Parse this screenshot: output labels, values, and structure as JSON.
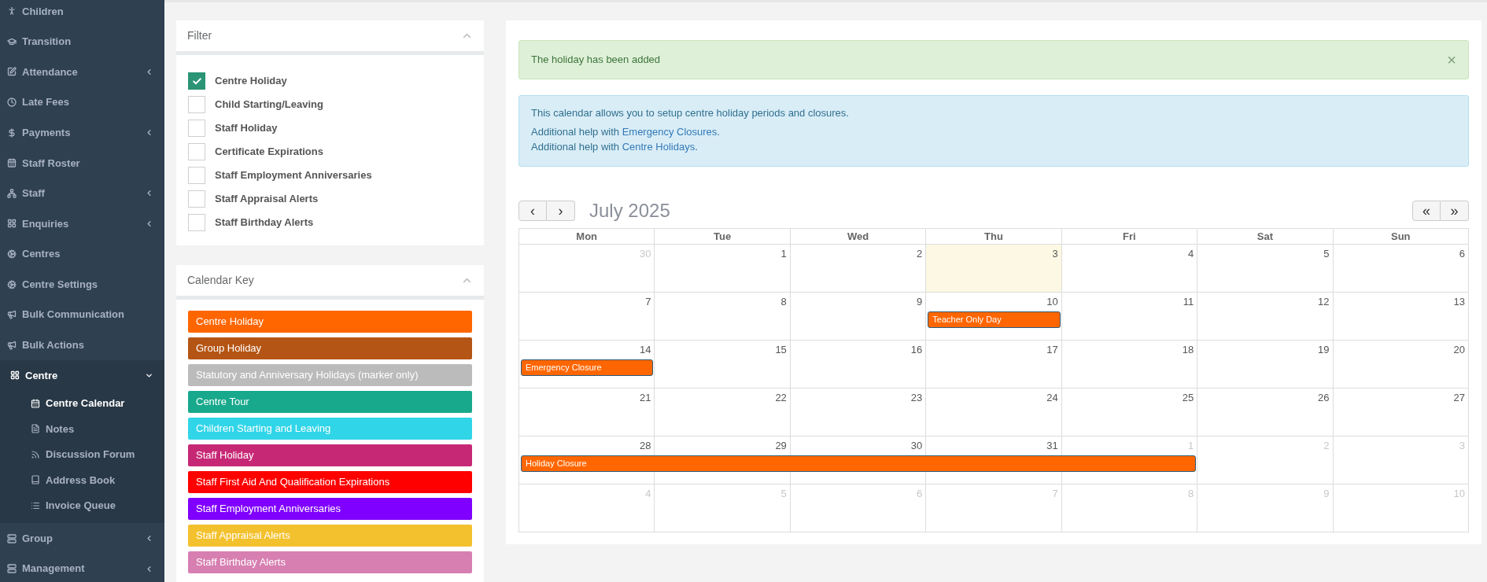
{
  "sidebar": {
    "items": [
      {
        "label": "Children",
        "has_caret": false,
        "selected": false
      },
      {
        "label": "Transition",
        "has_caret": false,
        "selected": false
      },
      {
        "label": "Attendance",
        "has_caret": true,
        "selected": false
      },
      {
        "label": "Late Fees",
        "has_caret": false,
        "selected": false
      },
      {
        "label": "Payments",
        "has_caret": true,
        "selected": false
      },
      {
        "label": "Staff Roster",
        "has_caret": false,
        "selected": false
      },
      {
        "label": "Staff",
        "has_caret": true,
        "selected": false
      },
      {
        "label": "Enquiries",
        "has_caret": true,
        "selected": false
      },
      {
        "label": "Centres",
        "has_caret": false,
        "selected": false
      },
      {
        "label": "Centre Settings",
        "has_caret": false,
        "selected": false
      },
      {
        "label": "Bulk Communication",
        "has_caret": false,
        "selected": false
      },
      {
        "label": "Bulk Actions",
        "has_caret": false,
        "selected": false
      },
      {
        "label": "Centre",
        "has_caret": true,
        "selected": true,
        "expanded": true,
        "children": [
          {
            "label": "Centre Calendar",
            "selected": true
          },
          {
            "label": "Notes",
            "selected": false
          },
          {
            "label": "Discussion Forum",
            "selected": false
          },
          {
            "label": "Address Book",
            "selected": false
          },
          {
            "label": "Invoice Queue",
            "selected": false
          }
        ]
      },
      {
        "label": "Group",
        "has_caret": true,
        "selected": false
      },
      {
        "label": "Management",
        "has_caret": true,
        "selected": false
      }
    ]
  },
  "filter": {
    "title": "Filter",
    "options": [
      {
        "label": "Centre Holiday",
        "checked": true
      },
      {
        "label": "Child Starting/Leaving",
        "checked": false
      },
      {
        "label": "Staff Holiday",
        "checked": false
      },
      {
        "label": "Certificate Expirations",
        "checked": false
      },
      {
        "label": "Staff Employment Anniversaries",
        "checked": false
      },
      {
        "label": "Staff Appraisal Alerts",
        "checked": false
      },
      {
        "label": "Staff Birthday Alerts",
        "checked": false
      }
    ]
  },
  "calendar_key": {
    "title": "Calendar Key",
    "items": [
      {
        "label": "Centre Holiday",
        "color": "#ff6600"
      },
      {
        "label": "Group Holiday",
        "color": "#b55515"
      },
      {
        "label": "Statutory and Anniversary Holidays (marker only)",
        "color": "#bbbbbb"
      },
      {
        "label": "Centre Tour",
        "color": "#18a98c"
      },
      {
        "label": "Children Starting and Leaving",
        "color": "#31d5e8"
      },
      {
        "label": "Staff Holiday",
        "color": "#c72876"
      },
      {
        "label": "Staff First Aid And Qualification Expirations",
        "color": "#ff0000"
      },
      {
        "label": "Staff Employment Anniversaries",
        "color": "#8000ff"
      },
      {
        "label": "Staff Appraisal Alerts",
        "color": "#f3c12e"
      },
      {
        "label": "Staff Birthday Alerts",
        "color": "#d77fb1"
      }
    ]
  },
  "success_alert": {
    "message": "The holiday has been added",
    "close": "×"
  },
  "info_alert": {
    "lines": [
      {
        "text": "This calendar allows you to setup centre holiday periods and closures."
      },
      {
        "text": "Additional help with ",
        "link": "Emergency Closures",
        "end": "."
      },
      {
        "text": "Additional help with ",
        "link": "Centre Holidays",
        "end": "."
      }
    ]
  },
  "calendar": {
    "title": "July 2025",
    "prev": "‹",
    "next": "›",
    "prev_year": "«",
    "next_year": "»",
    "weekdays": [
      "Mon",
      "Tue",
      "Wed",
      "Thu",
      "Fri",
      "Sat",
      "Sun"
    ],
    "weeks": [
      {
        "days": [
          {
            "day": "30",
            "other_month": true,
            "today": false
          },
          {
            "day": "1",
            "other_month": false,
            "today": false
          },
          {
            "day": "2",
            "other_month": false,
            "today": false
          },
          {
            "day": "3",
            "other_month": false,
            "today": true
          },
          {
            "day": "4",
            "other_month": false,
            "today": false
          },
          {
            "day": "5",
            "other_month": false,
            "today": false
          },
          {
            "day": "6",
            "other_month": false,
            "today": false
          }
        ]
      },
      {
        "days": [
          {
            "day": "7",
            "other_month": false,
            "today": false
          },
          {
            "day": "8",
            "other_month": false,
            "today": false
          },
          {
            "day": "9",
            "other_month": false,
            "today": false
          },
          {
            "day": "10",
            "other_month": false,
            "today": false,
            "event": {
              "title": "Teacher Only Day",
              "color": "#ff6600"
            }
          },
          {
            "day": "11",
            "other_month": false,
            "today": false
          },
          {
            "day": "12",
            "other_month": false,
            "today": false
          },
          {
            "day": "13",
            "other_month": false,
            "today": false
          }
        ]
      },
      {
        "days": [
          {
            "day": "14",
            "other_month": false,
            "today": false,
            "event": {
              "title": "Emergency Closure",
              "color": "#ff6600"
            }
          },
          {
            "day": "15",
            "other_month": false,
            "today": false
          },
          {
            "day": "16",
            "other_month": false,
            "today": false
          },
          {
            "day": "17",
            "other_month": false,
            "today": false
          },
          {
            "day": "18",
            "other_month": false,
            "today": false
          },
          {
            "day": "19",
            "other_month": false,
            "today": false
          },
          {
            "day": "20",
            "other_month": false,
            "today": false
          }
        ]
      },
      {
        "days": [
          {
            "day": "21",
            "other_month": false,
            "today": false
          },
          {
            "day": "22",
            "other_month": false,
            "today": false
          },
          {
            "day": "23",
            "other_month": false,
            "today": false
          },
          {
            "day": "24",
            "other_month": false,
            "today": false
          },
          {
            "day": "25",
            "other_month": false,
            "today": false
          },
          {
            "day": "26",
            "other_month": false,
            "today": false
          },
          {
            "day": "27",
            "other_month": false,
            "today": false
          }
        ]
      },
      {
        "days": [
          {
            "day": "28",
            "other_month": false,
            "today": false,
            "event": {
              "title": "Holiday Closure",
              "color": "#ff6600"
            }
          },
          {
            "day": "29",
            "other_month": false,
            "today": false,
            "in_event": true
          },
          {
            "day": "30",
            "other_month": false,
            "today": false,
            "in_event": true
          },
          {
            "day": "31",
            "other_month": false,
            "today": false,
            "in_event": true
          },
          {
            "day": "1",
            "other_month": true,
            "today": false,
            "in_event": true
          },
          {
            "day": "2",
            "other_month": true,
            "today": false
          },
          {
            "day": "3",
            "other_month": true,
            "today": false
          }
        ]
      },
      {
        "days": [
          {
            "day": "4",
            "other_month": true,
            "today": false
          },
          {
            "day": "5",
            "other_month": true,
            "today": false
          },
          {
            "day": "6",
            "other_month": true,
            "today": false
          },
          {
            "day": "7",
            "other_month": true,
            "today": false
          },
          {
            "day": "8",
            "other_month": true,
            "today": false
          },
          {
            "day": "9",
            "other_month": true,
            "today": false
          },
          {
            "day": "10",
            "other_month": true,
            "today": false
          }
        ]
      }
    ]
  }
}
